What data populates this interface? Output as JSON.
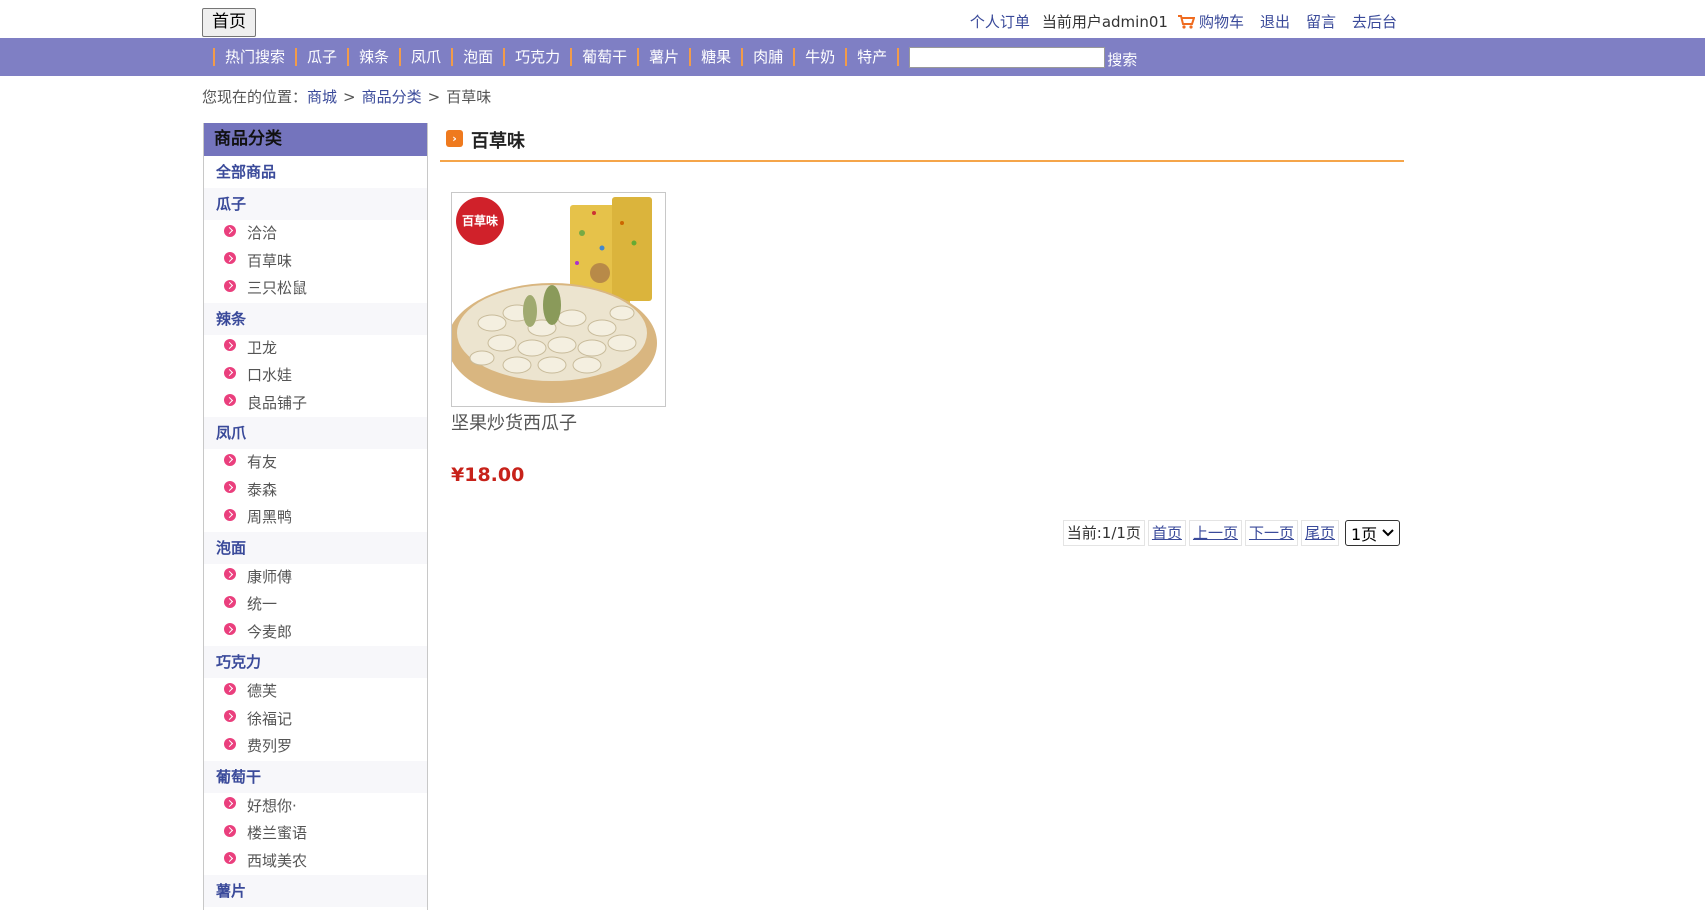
{
  "header": {
    "home_label": "首页",
    "links": {
      "orders": "个人订单",
      "user": "当前用户admin01",
      "cart": "购物车",
      "logout": "退出",
      "message": "留言",
      "admin": "去后台"
    }
  },
  "nav": {
    "items": [
      "热门搜索",
      "瓜子",
      "辣条",
      "凤爪",
      "泡面",
      "巧克力",
      "葡萄干",
      "薯片",
      "糖果",
      "肉脯",
      "牛奶",
      "特产"
    ],
    "search_label": "搜索",
    "search_value": ""
  },
  "breadcrumb": {
    "prefix": "您现在的位置：",
    "items": [
      "商城",
      "商品分类",
      "百草味"
    ],
    "separator": ">"
  },
  "sidebar": {
    "title": "商品分类",
    "all_label": "全部商品",
    "categories": [
      {
        "name": "瓜子",
        "items": [
          "洽洽",
          "百草味",
          "三只松鼠"
        ]
      },
      {
        "name": "辣条",
        "items": [
          "卫龙",
          "口水娃",
          "良品铺子"
        ]
      },
      {
        "name": "凤爪",
        "items": [
          "有友",
          "泰森",
          "周黑鸭"
        ]
      },
      {
        "name": "泡面",
        "items": [
          "康师傅",
          "统一",
          "今麦郎"
        ]
      },
      {
        "name": "巧克力",
        "items": [
          "德芙",
          "徐福记",
          "费列罗"
        ]
      },
      {
        "name": "葡萄干",
        "items": [
          "好想你·",
          "楼兰蜜语",
          "西域美农"
        ]
      },
      {
        "name": "薯片",
        "items": []
      }
    ]
  },
  "main": {
    "title": "百草味",
    "product": {
      "name": "坚果炒货西瓜子",
      "price": "¥18.00",
      "brand_logo_text": "百草味"
    },
    "pager": {
      "current": "当前:1/1页",
      "first": "首页",
      "prev": "上一页",
      "next": "下一页",
      "last": "尾页",
      "select_value": "1页"
    }
  },
  "colors": {
    "nav_bg": "#7f7fc4",
    "accent": "#f29b4a",
    "link": "#3a4a9a",
    "price": "#c7221a",
    "bullet": "#ea3f7d"
  }
}
